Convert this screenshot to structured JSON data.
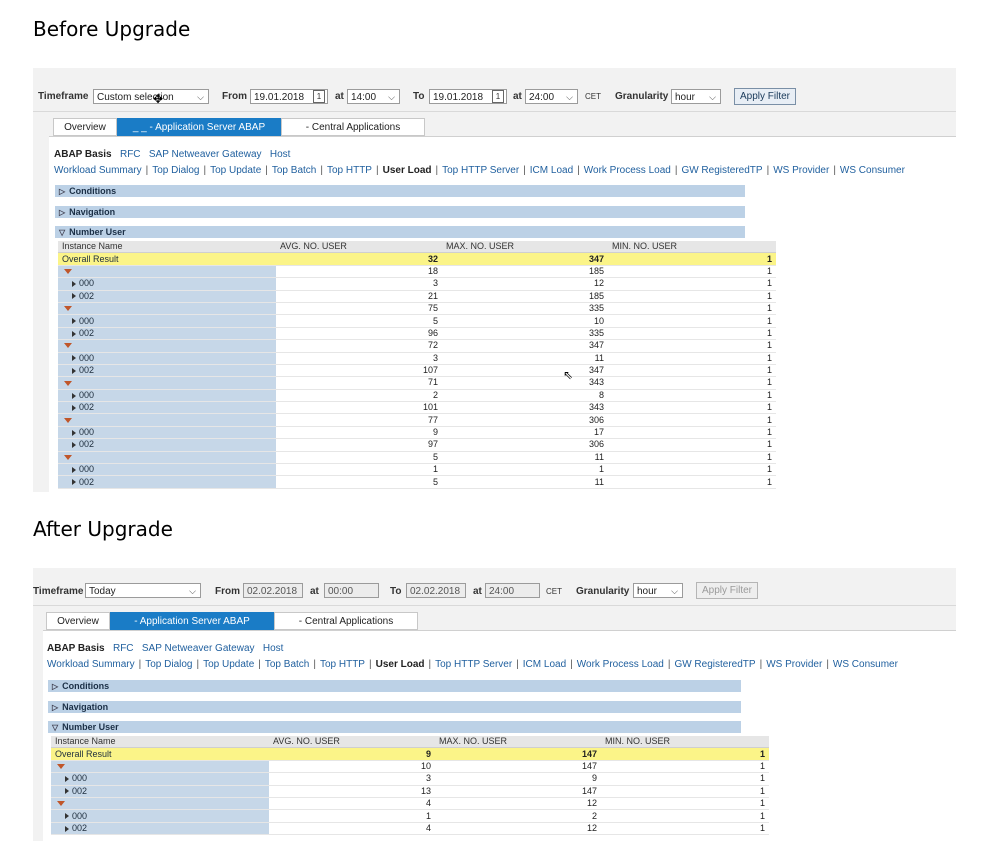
{
  "before": {
    "heading": "Before Upgrade",
    "filter": {
      "timeframe_label": "Timeframe",
      "timeframe_value": "Custom selection",
      "from_label": "From",
      "from_date": "19.01.2018",
      "at1_label": "at",
      "from_time": "14:00",
      "to_label": "To",
      "to_date": "19.01.2018",
      "at2_label": "at",
      "to_time": "24:00",
      "tz": "CET",
      "granularity_label": "Granularity",
      "granularity_value": "hour",
      "apply_label": "Apply Filter"
    },
    "tabs": [
      "Overview",
      "_ _ - Application Server ABAP",
      "- Central Applications"
    ],
    "subnav": [
      "ABAP Basis",
      "RFC",
      "SAP Netweaver Gateway",
      "Host"
    ],
    "links": [
      "Workload Summary",
      "Top Dialog",
      "Top Update",
      "Top Batch",
      "Top HTTP",
      "User Load",
      "Top HTTP Server",
      "ICM Load",
      "Work Process Load",
      "GW RegisteredTP",
      "WS Provider",
      "WS Consumer"
    ],
    "sections": [
      "Conditions",
      "Navigation",
      "Number User"
    ],
    "table": {
      "headers": [
        "Instance Name",
        "AVG. NO. USER",
        "MAX. NO. USER",
        "MIN. NO. USER"
      ],
      "overall": {
        "label": "Overall Result",
        "avg": "32",
        "max": "347",
        "min": "1"
      },
      "groups": [
        {
          "avg": "18",
          "max": "185",
          "min": "1",
          "rows": [
            {
              "name": "000",
              "avg": "3",
              "max": "12",
              "min": "1"
            },
            {
              "name": "002",
              "avg": "21",
              "max": "185",
              "min": "1"
            }
          ]
        },
        {
          "avg": "75",
          "max": "335",
          "min": "1",
          "rows": [
            {
              "name": "000",
              "avg": "5",
              "max": "10",
              "min": "1"
            },
            {
              "name": "002",
              "avg": "96",
              "max": "335",
              "min": "1"
            }
          ]
        },
        {
          "avg": "72",
          "max": "347",
          "min": "1",
          "rows": [
            {
              "name": "000",
              "avg": "3",
              "max": "11",
              "min": "1"
            },
            {
              "name": "002",
              "avg": "107",
              "max": "347",
              "min": "1"
            }
          ]
        },
        {
          "avg": "71",
          "max": "343",
          "min": "1",
          "rows": [
            {
              "name": "000",
              "avg": "2",
              "max": "8",
              "min": "1"
            },
            {
              "name": "002",
              "avg": "101",
              "max": "343",
              "min": "1"
            }
          ]
        },
        {
          "avg": "77",
          "max": "306",
          "min": "1",
          "rows": [
            {
              "name": "000",
              "avg": "9",
              "max": "17",
              "min": "1"
            },
            {
              "name": "002",
              "avg": "97",
              "max": "306",
              "min": "1"
            }
          ]
        },
        {
          "avg": "5",
          "max": "11",
          "min": "1",
          "rows": [
            {
              "name": "000",
              "avg": "1",
              "max": "1",
              "min": "1"
            },
            {
              "name": "002",
              "avg": "5",
              "max": "11",
              "min": "1"
            }
          ]
        }
      ]
    }
  },
  "after": {
    "heading": "After Upgrade",
    "filter": {
      "timeframe_label": "Timeframe",
      "timeframe_value": "Today",
      "from_label": "From",
      "from_date": "02.02.2018",
      "at1_label": "at",
      "from_time": "00:00",
      "to_label": "To",
      "to_date": "02.02.2018",
      "at2_label": "at",
      "to_time": "24:00",
      "tz": "CET",
      "granularity_label": "Granularity",
      "granularity_value": "hour",
      "apply_label": "Apply Filter"
    },
    "tabs": [
      "Overview",
      "- Application Server ABAP",
      "- Central Applications"
    ],
    "subnav": [
      "ABAP Basis",
      "RFC",
      "SAP Netweaver Gateway",
      "Host"
    ],
    "links": [
      "Workload Summary",
      "Top Dialog",
      "Top Update",
      "Top Batch",
      "Top HTTP",
      "User Load",
      "Top HTTP Server",
      "ICM Load",
      "Work Process Load",
      "GW RegisteredTP",
      "WS Provider",
      "WS Consumer"
    ],
    "sections": [
      "Conditions",
      "Navigation",
      "Number User"
    ],
    "table": {
      "headers": [
        "Instance Name",
        "AVG. NO. USER",
        "MAX. NO. USER",
        "MIN. NO. USER"
      ],
      "overall": {
        "label": "Overall Result",
        "avg": "9",
        "max": "147",
        "min": "1"
      },
      "groups": [
        {
          "avg": "10",
          "max": "147",
          "min": "1",
          "rows": [
            {
              "name": "000",
              "avg": "3",
              "max": "9",
              "min": "1"
            },
            {
              "name": "002",
              "avg": "13",
              "max": "147",
              "min": "1"
            }
          ]
        },
        {
          "avg": "4",
          "max": "12",
          "min": "1",
          "rows": [
            {
              "name": "000",
              "avg": "1",
              "max": "2",
              "min": "1"
            },
            {
              "name": "002",
              "avg": "4",
              "max": "12",
              "min": "1"
            }
          ]
        }
      ]
    }
  },
  "icons": {
    "calendar": "calendar-icon",
    "dropdown": "chevron-down-icon",
    "expand": "triangle-down-icon",
    "collapse": "triangle-right-icon"
  }
}
